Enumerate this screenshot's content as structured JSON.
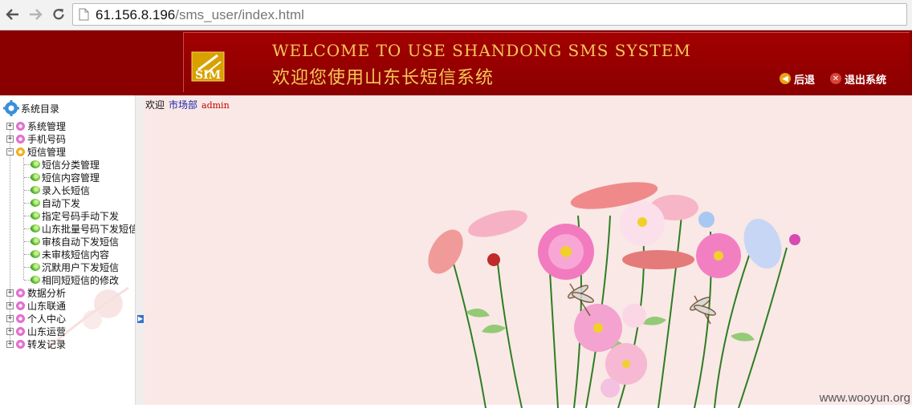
{
  "browser": {
    "url_host": "61.156.8.196",
    "url_path": "/sms_user/index.html"
  },
  "header": {
    "title_en": "WELCOME TO USE SHANDONG SMS SYSTEM",
    "title_cn": "欢迎您使用山东长短信系统",
    "logo_text": "SIM",
    "back_label": "后退",
    "logout_label": "退出系统"
  },
  "sidebar": {
    "title": "系统目录",
    "items": [
      {
        "label": "系统管理"
      },
      {
        "label": "手机号码"
      },
      {
        "label": "短信管理",
        "children": [
          {
            "label": "短信分类管理"
          },
          {
            "label": "短信内容管理"
          },
          {
            "label": "录入长短信"
          },
          {
            "label": "自动下发"
          },
          {
            "label": "指定号码手动下发"
          },
          {
            "label": "山东批量号码下发短信"
          },
          {
            "label": "审核自动下发短信"
          },
          {
            "label": "未审核短信内容"
          },
          {
            "label": "沉默用户下发短信"
          },
          {
            "label": "相同短短信的修改"
          }
        ]
      },
      {
        "label": "数据分析"
      },
      {
        "label": "山东联通"
      },
      {
        "label": "个人中心"
      },
      {
        "label": "山东运营"
      },
      {
        "label": "转发记录"
      }
    ]
  },
  "main": {
    "welcome_label": "欢迎",
    "department": "市场部",
    "username": "admin"
  },
  "watermark": "www.wooyun.org",
  "colors": {
    "header_bg": "#8a0000",
    "title_gold": "#f6c85a",
    "content_bg": "#f9e8e6",
    "dept_blue": "#1a24a8",
    "user_red": "#c00000"
  }
}
